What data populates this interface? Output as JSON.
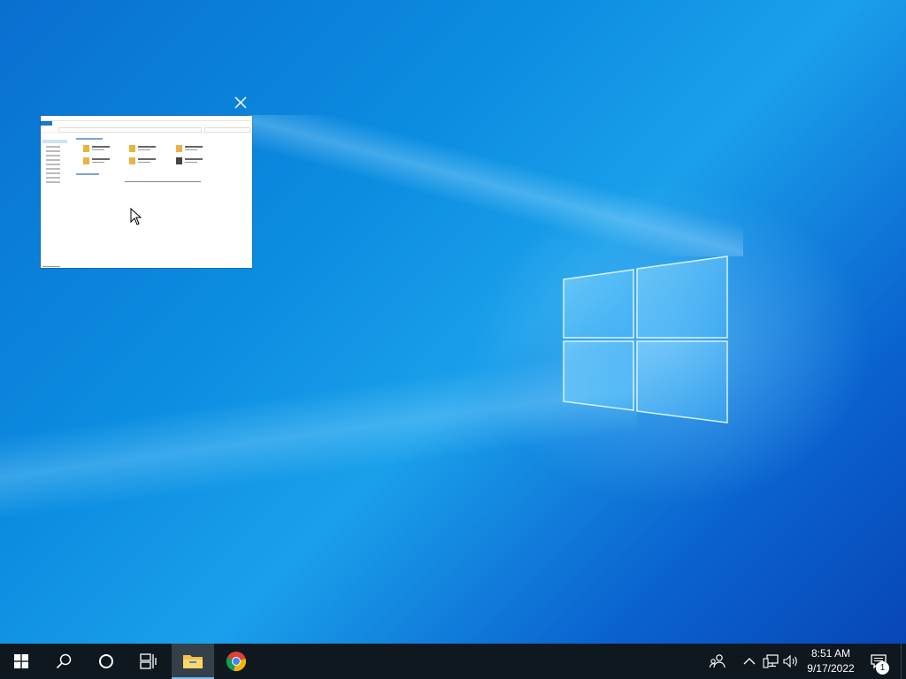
{
  "taskbar": {
    "clock": {
      "time": "8:51 AM",
      "date": "9/17/2022"
    },
    "notification_count": "1",
    "pinned": [
      {
        "name": "start",
        "icon": "windows-logo-icon"
      },
      {
        "name": "search",
        "icon": "search-icon"
      },
      {
        "name": "cortana",
        "icon": "cortana-circle-icon"
      },
      {
        "name": "task-view",
        "icon": "task-view-icon"
      },
      {
        "name": "file-explorer",
        "icon": "folder-icon",
        "active": true
      },
      {
        "name": "chrome",
        "icon": "chrome-icon"
      }
    ],
    "tray": [
      "people-icon",
      "chevron-up-icon",
      "network-icon",
      "volume-icon",
      "action-center-icon"
    ]
  },
  "window_preview": {
    "app": "File Explorer",
    "close_icon": "close-icon"
  },
  "colors": {
    "taskbar": "#10181f",
    "active_underline": "#76b9ed",
    "desktop_blue": "#0b8de0"
  }
}
